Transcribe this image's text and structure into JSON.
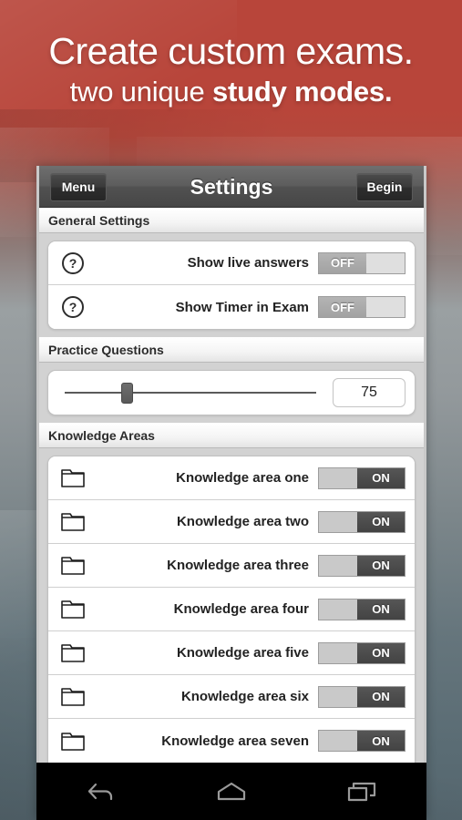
{
  "promo": {
    "headline_main": "Create custom exams.",
    "headline_sub_light": "two unique ",
    "headline_sub_bold": "study modes.",
    "background_top_color": "#b8453a",
    "background_bottom_color": "#55666e"
  },
  "app": {
    "title_bar": {
      "menu_label": "Menu",
      "title": "Settings",
      "begin_label": "Begin"
    },
    "sections": [
      {
        "header": "General Settings",
        "rows": [
          {
            "icon": "question-mark-icon",
            "label": "Show live answers",
            "toggle_state": "OFF"
          },
          {
            "icon": "question-mark-icon",
            "label": "Show Timer in Exam",
            "toggle_state": "OFF"
          }
        ]
      },
      {
        "header": "Practice Questions",
        "slider": {
          "value": "75",
          "thumb_percent": 24,
          "min_label": "",
          "max_label": ""
        }
      },
      {
        "header": "Knowledge Areas",
        "rows": [
          {
            "icon": "folder-icon",
            "label": "Knowledge area one",
            "toggle_state": "ON"
          },
          {
            "icon": "folder-icon",
            "label": "Knowledge area two",
            "toggle_state": "ON"
          },
          {
            "icon": "folder-icon",
            "label": "Knowledge area three",
            "toggle_state": "ON"
          },
          {
            "icon": "folder-icon",
            "label": "Knowledge area four",
            "toggle_state": "ON"
          },
          {
            "icon": "folder-icon",
            "label": "Knowledge area five",
            "toggle_state": "ON"
          },
          {
            "icon": "folder-icon",
            "label": "Knowledge area six",
            "toggle_state": "ON"
          },
          {
            "icon": "folder-icon",
            "label": "Knowledge area seven",
            "toggle_state": "ON"
          }
        ]
      }
    ],
    "nav_bar": {
      "back_icon": "back-arrow-icon",
      "home_icon": "home-icon",
      "recents_icon": "recent-apps-icon"
    },
    "colors": {
      "toggle_on_knob": "#434343",
      "toggle_off_knob": "#a2a2a2",
      "title_bar": "#515151",
      "card_background": "#ffffff"
    }
  }
}
